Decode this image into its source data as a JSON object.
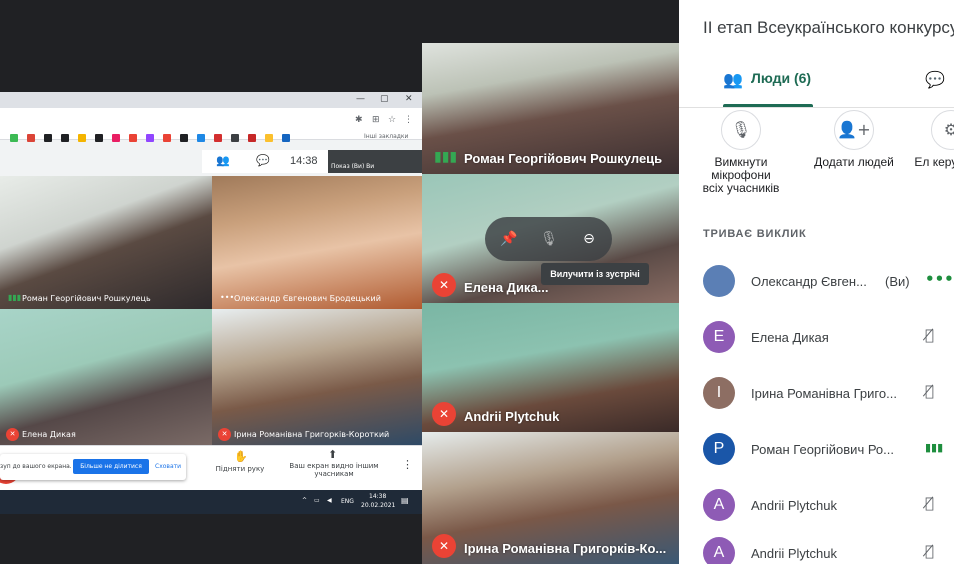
{
  "share": {
    "window_controls": [
      "—",
      "▢",
      "✕"
    ],
    "other_bookmarks": "Інші закладки",
    "time": "14:38",
    "mini_self_label": "Показ (Ви)  Ви",
    "tiles": [
      {
        "name": "Роман Георгійович Рошкулець",
        "state": "speaking"
      },
      {
        "name": "Олександр Євгенович Бродецький",
        "state": "menu"
      },
      {
        "name": "Елена Дикая",
        "state": "muted"
      },
      {
        "name": "Ірина Романівна Григорків-Короткий",
        "state": "muted"
      }
    ],
    "notice_text": "зуп до вашого екрана.",
    "notice_stop": "Більше не ділитися",
    "notice_hide": "Сховати",
    "raise_hand": "Підняти руку",
    "sharing_label": "Ваш екран видно іншим учасникам",
    "taskbar_lang": "ENG",
    "taskbar_time": "14:38",
    "taskbar_date": "20.02.2021"
  },
  "middle": {
    "tiles": [
      {
        "name": "Роман Георгійович Рошкулець",
        "state": "speaking"
      },
      {
        "name": "Елена Дика...",
        "state": "muted"
      },
      {
        "name": "Andrii Plytchuk",
        "state": "muted"
      },
      {
        "name": "Ірина Романівна Григорків-Ко...",
        "state": "muted"
      }
    ],
    "tooltip": "Вилучити із зустрічі"
  },
  "panel": {
    "title": "ІІ етап Всеукраїнського конкурсу",
    "tab_people": "Люди (6)",
    "actions": [
      {
        "label": "Вимкнути мікрофони всіх учасників",
        "icon": "mic-off-icon"
      },
      {
        "label": "Додати людей",
        "icon": "person-add-icon"
      },
      {
        "label": "Ел керу розм",
        "icon": "more-icon"
      }
    ],
    "section": "ТРИВАЄ ВИКЛИК",
    "people": [
      {
        "initial": "",
        "name": "Олександр Євген...",
        "you": "(Ви)",
        "state": "•••",
        "color": "#5b7fb5"
      },
      {
        "initial": "E",
        "name": "Елена Дикая",
        "you": "",
        "state": "🎙̸",
        "color": "#8e5bb5"
      },
      {
        "initial": "I",
        "name": "Ірина Романівна Григо...",
        "you": "",
        "state": "🎙̸",
        "color": "#8d6e63"
      },
      {
        "initial": "P",
        "name": "Роман Георгійович Ро...",
        "you": "",
        "state": "▮▮▮",
        "color": "#1a56a8"
      },
      {
        "initial": "A",
        "name": "Andrii Plytchuk",
        "you": "",
        "state": "🎙̸",
        "color": "#8e5bb5"
      },
      {
        "initial": "A",
        "name": "Andrii Plytchuk",
        "you": "",
        "state": "🎙̸",
        "color": "#8e5bb5"
      }
    ]
  }
}
